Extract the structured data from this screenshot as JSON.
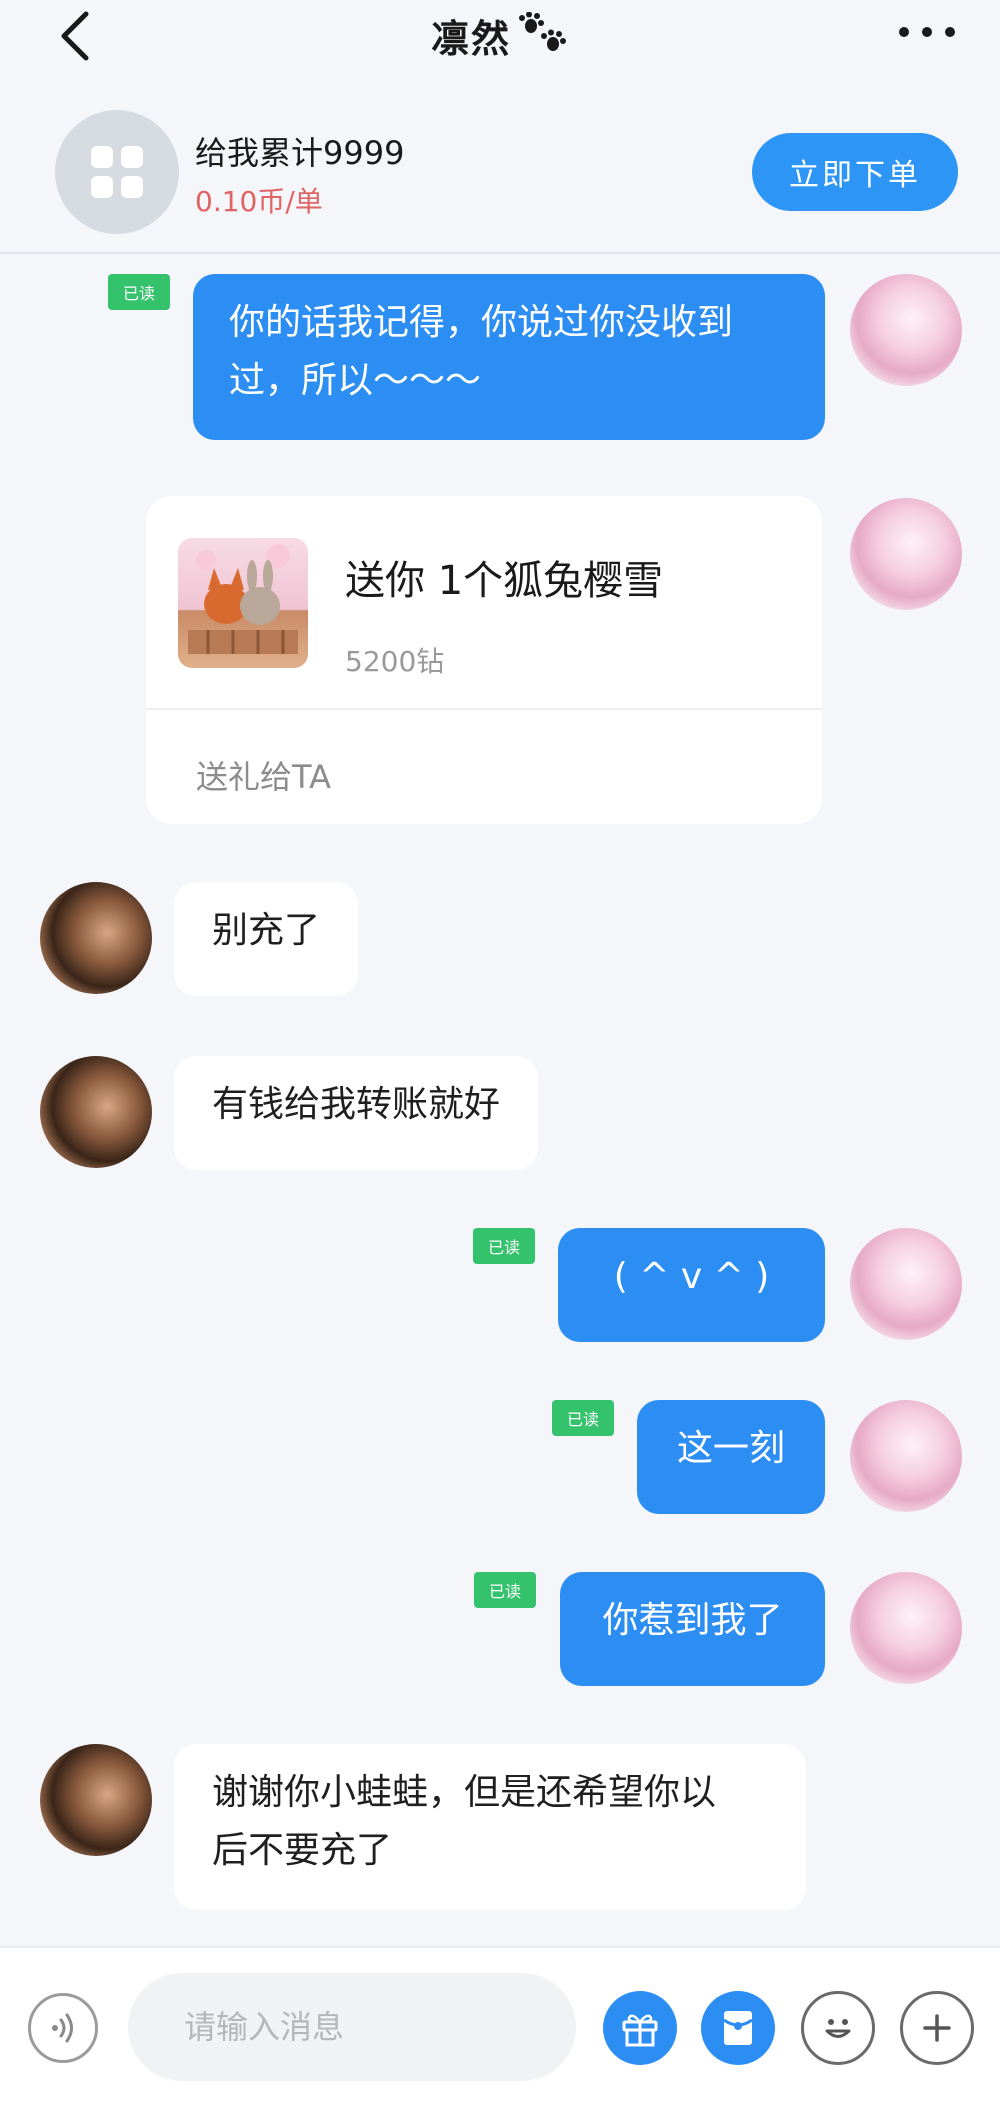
{
  "header": {
    "title": "凛然",
    "back_icon": "chevron-left-icon",
    "more_icon": "more-horizontal-icon",
    "title_icon": "paw-prints-icon"
  },
  "order": {
    "icon": "app-grid-icon",
    "title": "给我累计9999",
    "price": "0.10币/单",
    "button_label": "立即下单",
    "accent_color": "#2c95f5",
    "price_color": "#e06464"
  },
  "messages": [
    {
      "sender": "me",
      "read_label": "已读",
      "text_line1": "你的话我记得，你说过你没收到",
      "text_line2": "过，所以～～～"
    },
    {
      "sender": "me",
      "type": "gift",
      "gift_name": "送你 1个狐兔樱雪",
      "gift_price": "5200钻",
      "gift_action": "送礼给TA"
    },
    {
      "sender": "other",
      "text": "别充了"
    },
    {
      "sender": "other",
      "text": "有钱给我转账就好"
    },
    {
      "sender": "me",
      "read_label": "已读",
      "text": "( ^ v ^ )"
    },
    {
      "sender": "me",
      "read_label": "已读",
      "text": "这一刻"
    },
    {
      "sender": "me",
      "read_label": "已读",
      "text": "你惹到我了"
    },
    {
      "sender": "other",
      "text_line1": "谢谢你小蛙蛙，但是还希望你以",
      "text_line2": "后不要充了"
    }
  ],
  "input_bar": {
    "placeholder": "请输入消息",
    "voice_icon": "voice-icon",
    "gift_icon": "gift-icon",
    "red_packet_icon": "red-packet-icon",
    "emoji_icon": "emoji-icon",
    "plus_icon": "plus-icon"
  },
  "colors": {
    "my_bubble": "#2c8ef3",
    "read_badge": "#34c26d",
    "background": "#f4f6f9"
  }
}
